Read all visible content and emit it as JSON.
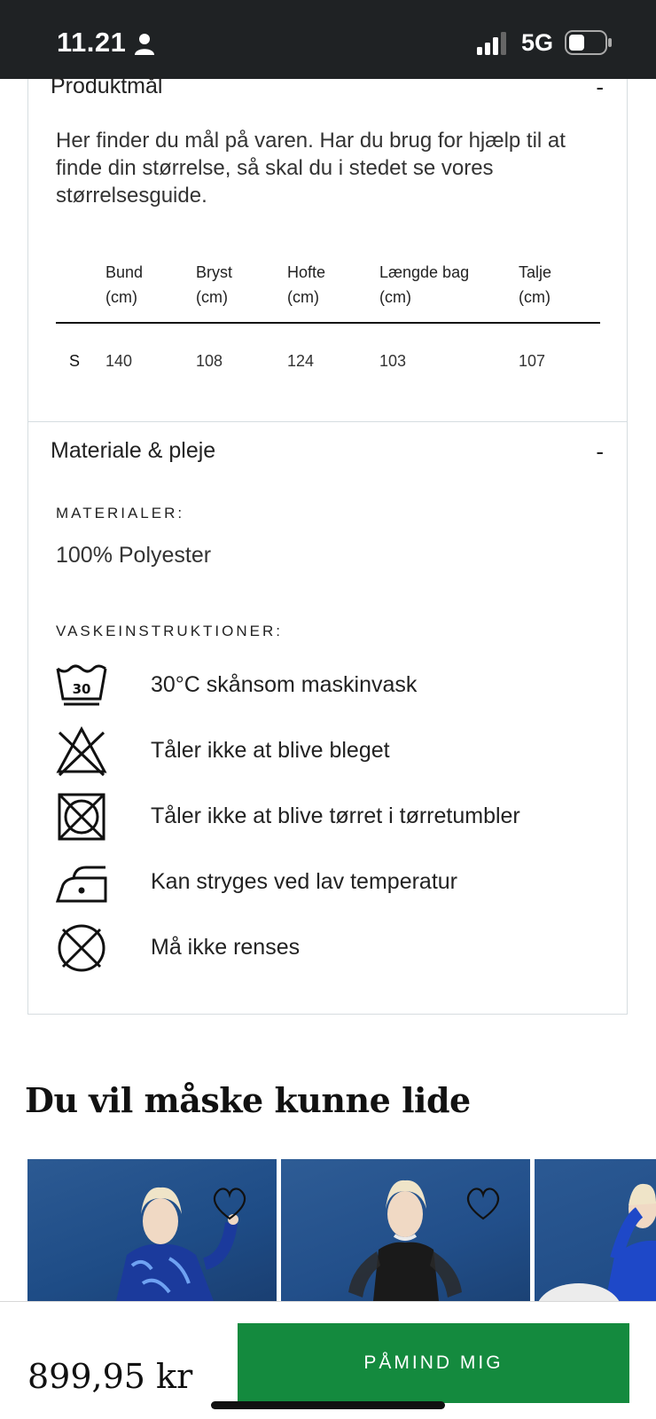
{
  "status_bar": {
    "time": "11.21",
    "network": "5G"
  },
  "measurements": {
    "title": "Produktmål",
    "toggle": "-",
    "intro": "Her finder du mål på varen. Har du brug for hjælp til at finde din størrelse, så skal du i stedet se vores størrelsesguide.",
    "columns": [
      {
        "name": "Bund",
        "unit": "(cm)"
      },
      {
        "name": "Bryst",
        "unit": "(cm)"
      },
      {
        "name": "Hofte",
        "unit": "(cm)"
      },
      {
        "name": "Længde bag",
        "unit": "(cm)"
      },
      {
        "name": "Talje",
        "unit": "(cm)"
      }
    ],
    "rows": [
      {
        "size": "S",
        "values": [
          "140",
          "108",
          "124",
          "103",
          "107"
        ]
      }
    ]
  },
  "materials": {
    "title": "Materiale & pleje",
    "toggle": "-",
    "materials_label": "MATERIALER:",
    "material_value": "100% Polyester",
    "wash_label": "VASKEINSTRUKTIONER:",
    "care": [
      {
        "icon": "wash-30-icon",
        "badge": "30",
        "text": "30°C skånsom maskinvask"
      },
      {
        "icon": "no-bleach-icon",
        "text": "Tåler ikke at blive bleget"
      },
      {
        "icon": "no-tumble-dry-icon",
        "text": "Tåler ikke at blive tørret i tørretumbler"
      },
      {
        "icon": "iron-low-icon",
        "text": "Kan stryges ved lav temperatur"
      },
      {
        "icon": "no-dry-clean-icon",
        "text": "Må ikke renses"
      }
    ]
  },
  "recommendations": {
    "title": "Du vil måske kunne lide"
  },
  "footer": {
    "price": "899,95 kr",
    "cta": "PÅMIND MIG"
  },
  "colors": {
    "cta": "#148a3e",
    "status_bar": "#1f2224",
    "product_bg": "#1e4c86"
  }
}
